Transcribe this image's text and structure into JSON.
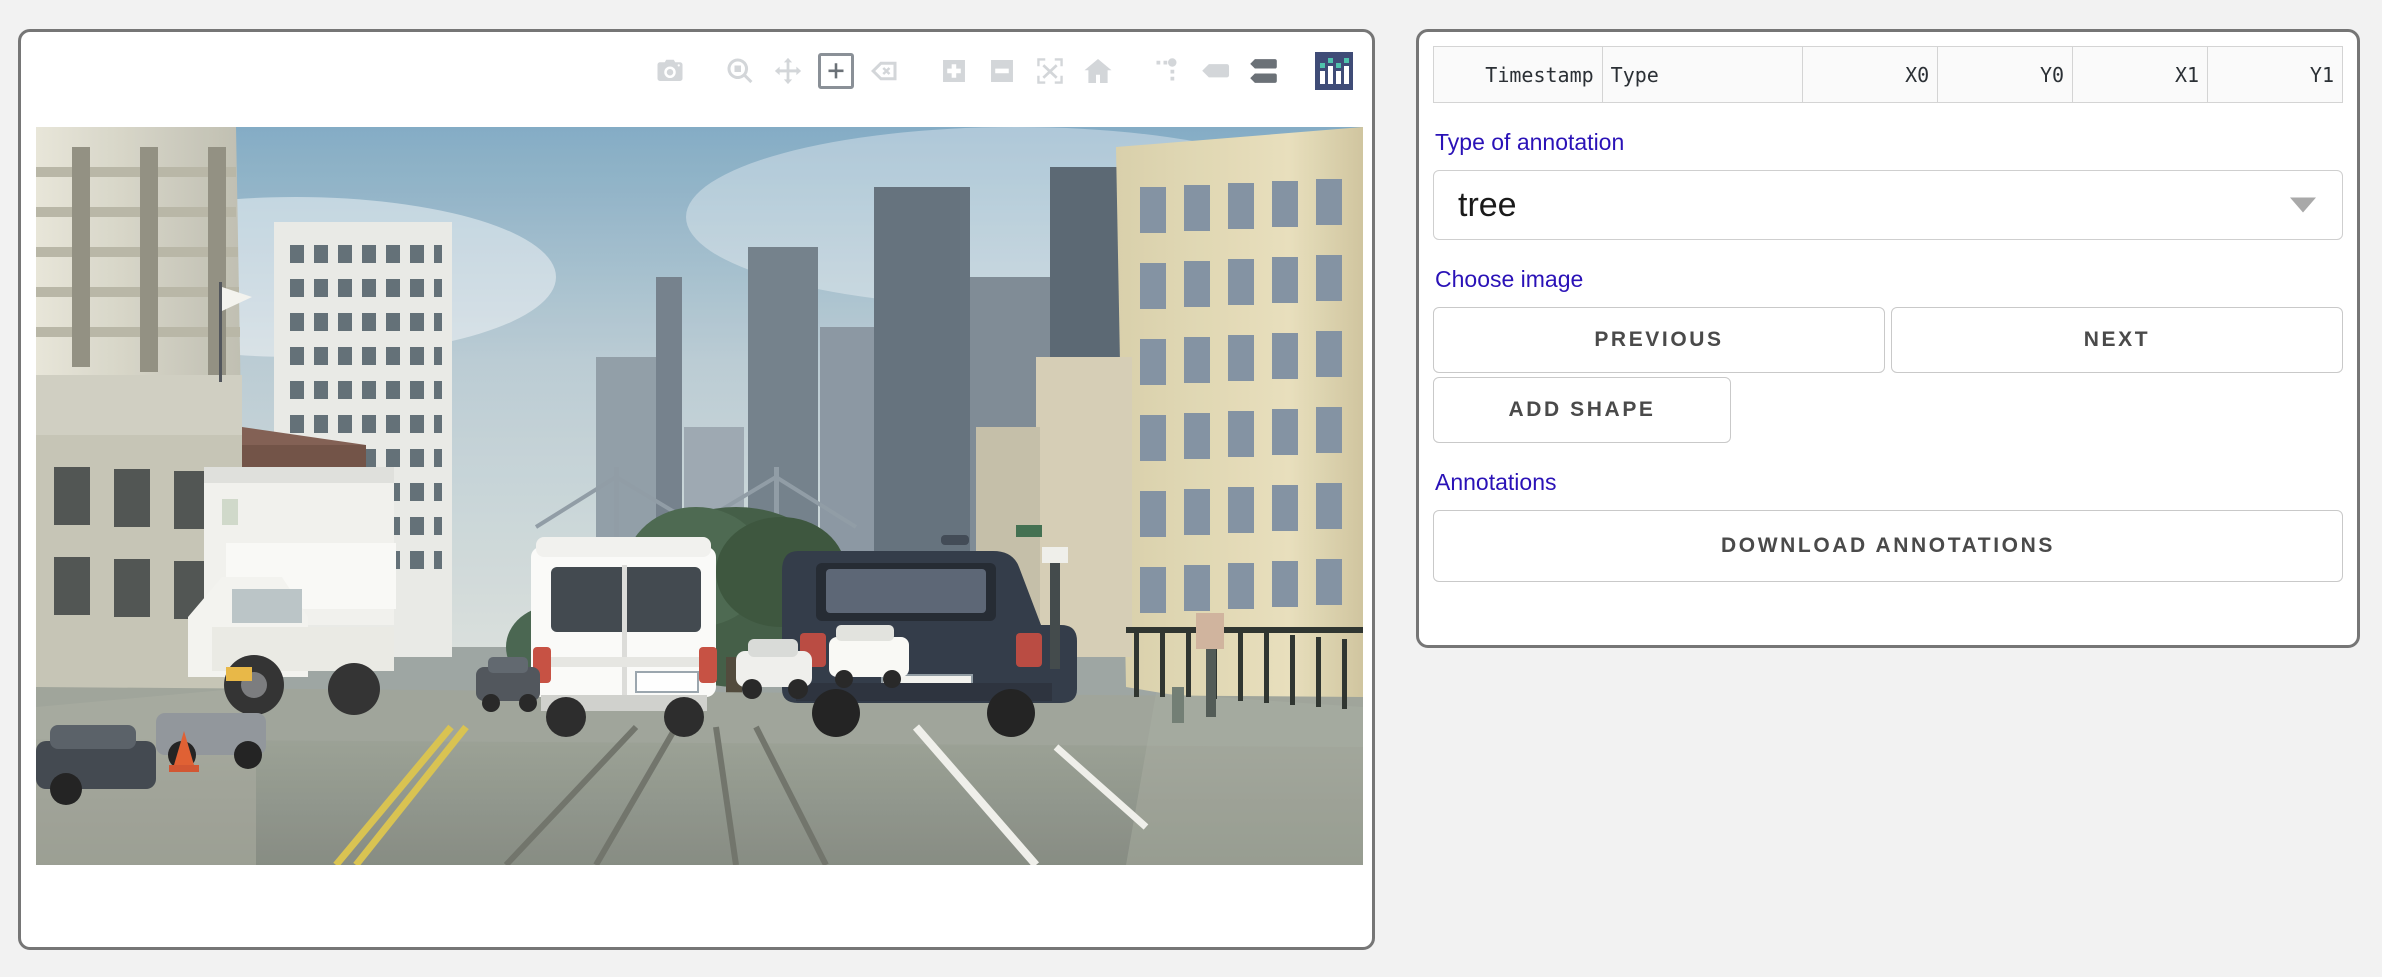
{
  "page": {
    "background": "#f2f2f2",
    "panel_border": "#767676"
  },
  "graph_panel": {
    "modebar": {
      "buttons": [
        {
          "name": "download-plot-png-icon",
          "title": "Download plot as a png",
          "state": "inactive"
        },
        {
          "name": "zoom-icon",
          "title": "Zoom",
          "state": "inactive"
        },
        {
          "name": "pan-icon",
          "title": "Pan",
          "state": "inactive"
        },
        {
          "name": "draw-rectangle-icon",
          "title": "Draw rectangle",
          "state": "active"
        },
        {
          "name": "erase-shape-icon",
          "title": "Erase active shape",
          "state": "inactive"
        },
        {
          "name": "zoom-in-icon",
          "title": "Zoom in",
          "state": "inactive"
        },
        {
          "name": "zoom-out-icon",
          "title": "Zoom out",
          "state": "inactive"
        },
        {
          "name": "autoscale-icon",
          "title": "Autoscale",
          "state": "inactive"
        },
        {
          "name": "reset-axes-home-icon",
          "title": "Reset axes",
          "state": "inactive"
        },
        {
          "name": "toggle-spike-lines-icon",
          "title": "Toggle Spike Lines",
          "state": "inactive"
        },
        {
          "name": "hover-closest-icon",
          "title": "Show closest data on hover",
          "state": "inactive"
        },
        {
          "name": "hover-compare-icon",
          "title": "Compare data on hover",
          "state": "active"
        },
        {
          "name": "plotly-logo-icon",
          "title": "Produced with Plotly",
          "state": "brand"
        }
      ],
      "logo_colors": {
        "background": "#3f4c77",
        "bars": "#ffffff",
        "dots": "#4fc3ac"
      }
    },
    "image": {
      "name": "street-scene-photo",
      "description": "Downtown San Francisco street view from a vehicle: a white box truck on the left, a white cargo van directly ahead, a dark SUV on the right, cable-car tracks in the roadway and high-rise towers with the Bay Bridge in the distance."
    }
  },
  "side_panel": {
    "table": {
      "columns": [
        {
          "key": "timestamp",
          "label": "Timestamp",
          "align": "right"
        },
        {
          "key": "type",
          "label": "Type",
          "align": "left"
        },
        {
          "key": "x0",
          "label": "X0",
          "align": "right"
        },
        {
          "key": "y0",
          "label": "Y0",
          "align": "right"
        },
        {
          "key": "x1",
          "label": "X1",
          "align": "right"
        },
        {
          "key": "y1",
          "label": "Y1",
          "align": "right"
        }
      ],
      "rows": []
    },
    "type_of_annotation": {
      "label": "Type of annotation",
      "selected": "tree"
    },
    "choose_image": {
      "label": "Choose image",
      "previous_label": "PREVIOUS",
      "next_label": "NEXT",
      "add_shape_label": "ADD SHAPE"
    },
    "annotations": {
      "label": "Annotations",
      "download_label": "DOWNLOAD ANNOTATIONS"
    },
    "label_color": "#2a12b7"
  }
}
